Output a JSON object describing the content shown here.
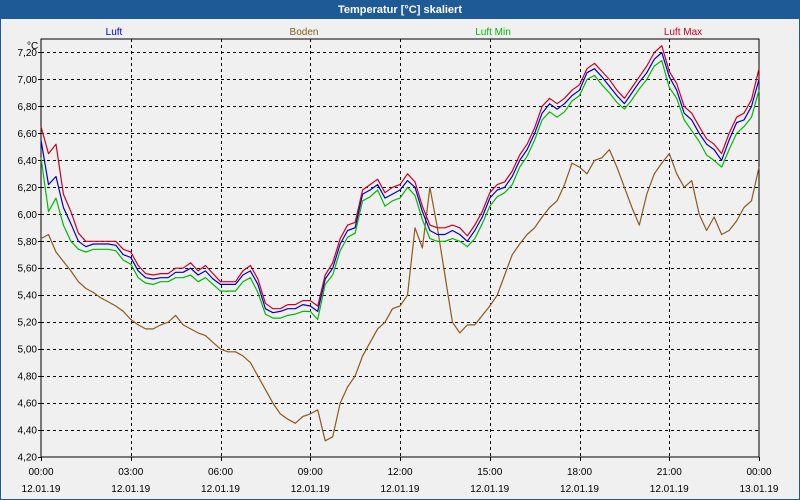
{
  "window": {
    "title": "Temperatur [°C] skaliert"
  },
  "colors": {
    "background": "#f0f0f0",
    "titlebar": "#1e5a96",
    "luft": "#0000cc",
    "boden": "#8b5a1e",
    "luft_min": "#00bb00",
    "luft_max": "#cc0022"
  },
  "chart_data": {
    "type": "line",
    "title": "Temperatur [°C] skaliert",
    "unit": "°C",
    "ylim": [
      4.2,
      7.3
    ],
    "xlim": [
      0,
      24
    ],
    "yticks": [
      4.2,
      4.4,
      4.6,
      4.8,
      5.0,
      5.2,
      5.4,
      5.6,
      5.8,
      6.0,
      6.2,
      6.4,
      6.6,
      6.8,
      7.0,
      7.2
    ],
    "ytick_labels": [
      "4,20",
      "4,40",
      "4,60",
      "4,80",
      "5,00",
      "5,20",
      "5,40",
      "5,60",
      "5,80",
      "6,00",
      "6,20",
      "6,40",
      "6,60",
      "6,80",
      "7,00",
      "7,20"
    ],
    "xticks": [
      {
        "time": "00:00",
        "date": "12.01.19",
        "hour": 0
      },
      {
        "time": "03:00",
        "date": "12.01.19",
        "hour": 3
      },
      {
        "time": "06:00",
        "date": "12.01.19",
        "hour": 6
      },
      {
        "time": "09:00",
        "date": "12.01.19",
        "hour": 9
      },
      {
        "time": "12:00",
        "date": "12.01.19",
        "hour": 12
      },
      {
        "time": "15:00",
        "date": "12.01.19",
        "hour": 15
      },
      {
        "time": "18:00",
        "date": "12.01.19",
        "hour": 18
      },
      {
        "time": "21:00",
        "date": "12.01.19",
        "hour": 21
      },
      {
        "time": "00:00",
        "date": "13.01.19",
        "hour": 24
      }
    ],
    "grid": true,
    "legend_position": "top",
    "x": [
      0,
      0.25,
      0.5,
      0.75,
      1,
      1.25,
      1.5,
      1.75,
      2,
      2.25,
      2.5,
      2.75,
      3,
      3.25,
      3.5,
      3.75,
      4,
      4.25,
      4.5,
      4.75,
      5,
      5.25,
      5.5,
      5.75,
      6,
      6.25,
      6.5,
      6.75,
      7,
      7.25,
      7.5,
      7.75,
      8,
      8.25,
      8.5,
      8.75,
      9,
      9.25,
      9.5,
      9.75,
      10,
      10.25,
      10.5,
      10.75,
      11,
      11.25,
      11.5,
      11.75,
      12,
      12.25,
      12.5,
      12.75,
      13,
      13.25,
      13.5,
      13.75,
      14,
      14.25,
      14.5,
      14.75,
      15,
      15.25,
      15.5,
      15.75,
      16,
      16.25,
      16.5,
      16.75,
      17,
      17.25,
      17.5,
      17.75,
      18,
      18.25,
      18.5,
      18.75,
      19,
      19.25,
      19.5,
      19.75,
      20,
      20.25,
      20.5,
      20.75,
      21,
      21.25,
      21.5,
      21.75,
      22,
      22.25,
      22.5,
      22.75,
      23,
      23.25,
      23.5,
      23.75,
      24
    ],
    "series": [
      {
        "name": "Luft",
        "color": "#0000cc",
        "values": [
          6.55,
          6.22,
          6.28,
          6.05,
          5.93,
          5.8,
          5.76,
          5.78,
          5.78,
          5.78,
          5.77,
          5.7,
          5.68,
          5.58,
          5.53,
          5.52,
          5.53,
          5.53,
          5.57,
          5.57,
          5.6,
          5.55,
          5.58,
          5.52,
          5.48,
          5.48,
          5.48,
          5.55,
          5.58,
          5.48,
          5.3,
          5.27,
          5.28,
          5.3,
          5.3,
          5.33,
          5.32,
          5.28,
          5.52,
          5.6,
          5.78,
          5.88,
          5.9,
          6.15,
          6.18,
          6.22,
          6.12,
          6.15,
          6.18,
          6.25,
          6.2,
          6.02,
          5.88,
          5.85,
          5.85,
          5.88,
          5.85,
          5.8,
          5.88,
          5.98,
          6.12,
          6.18,
          6.2,
          6.28,
          6.4,
          6.48,
          6.6,
          6.75,
          6.82,
          6.78,
          6.82,
          6.88,
          6.92,
          7.05,
          7.08,
          7.02,
          6.95,
          6.88,
          6.82,
          6.9,
          6.98,
          7.05,
          7.15,
          7.2,
          7.02,
          6.92,
          6.75,
          6.7,
          6.6,
          6.52,
          6.48,
          6.4,
          6.55,
          6.68,
          6.7,
          6.8,
          7.0
        ]
      },
      {
        "name": "Boden",
        "color": "#8b5a1e",
        "values": [
          5.82,
          5.85,
          5.72,
          5.65,
          5.58,
          5.5,
          5.45,
          5.42,
          5.38,
          5.35,
          5.32,
          5.28,
          5.22,
          5.18,
          5.15,
          5.15,
          5.18,
          5.2,
          5.25,
          5.18,
          5.15,
          5.12,
          5.1,
          5.05,
          5.0,
          4.98,
          4.98,
          4.95,
          4.9,
          4.8,
          4.7,
          4.6,
          4.52,
          4.48,
          4.45,
          4.5,
          4.52,
          4.55,
          4.32,
          4.35,
          4.6,
          4.72,
          4.8,
          4.95,
          5.05,
          5.15,
          5.2,
          5.3,
          5.32,
          5.4,
          5.9,
          5.75,
          6.2,
          5.9,
          5.55,
          5.2,
          5.12,
          5.18,
          5.18,
          5.25,
          5.32,
          5.4,
          5.55,
          5.7,
          5.78,
          5.85,
          5.9,
          5.98,
          6.05,
          6.1,
          6.22,
          6.38,
          6.35,
          6.3,
          6.4,
          6.42,
          6.48,
          6.35,
          6.2,
          6.05,
          5.92,
          6.15,
          6.3,
          6.38,
          6.45,
          6.3,
          6.2,
          6.25,
          6.0,
          5.88,
          5.98,
          5.85,
          5.88,
          5.95,
          6.05,
          6.1,
          6.35
        ]
      },
      {
        "name": "Luft Min",
        "color": "#00bb00",
        "values": [
          6.42,
          6.02,
          6.12,
          5.92,
          5.8,
          5.74,
          5.72,
          5.74,
          5.74,
          5.74,
          5.73,
          5.66,
          5.63,
          5.53,
          5.49,
          5.48,
          5.5,
          5.5,
          5.53,
          5.53,
          5.55,
          5.5,
          5.53,
          5.48,
          5.43,
          5.43,
          5.43,
          5.5,
          5.53,
          5.42,
          5.26,
          5.23,
          5.23,
          5.25,
          5.26,
          5.28,
          5.28,
          5.22,
          5.48,
          5.55,
          5.73,
          5.83,
          5.86,
          6.1,
          6.13,
          6.18,
          6.06,
          6.1,
          6.12,
          6.2,
          6.14,
          5.96,
          5.82,
          5.8,
          5.8,
          5.82,
          5.8,
          5.76,
          5.82,
          5.93,
          6.06,
          6.13,
          6.16,
          6.22,
          6.35,
          6.43,
          6.55,
          6.7,
          6.76,
          6.72,
          6.76,
          6.84,
          6.88,
          7.0,
          7.03,
          6.96,
          6.9,
          6.83,
          6.78,
          6.85,
          6.93,
          7.0,
          7.1,
          7.14,
          6.94,
          6.86,
          6.7,
          6.62,
          6.54,
          6.44,
          6.4,
          6.35,
          6.48,
          6.6,
          6.65,
          6.72,
          6.92
        ]
      },
      {
        "name": "Luft Max",
        "color": "#cc0022",
        "values": [
          6.65,
          6.45,
          6.52,
          6.15,
          6.02,
          5.86,
          5.8,
          5.8,
          5.8,
          5.8,
          5.8,
          5.74,
          5.72,
          5.62,
          5.56,
          5.55,
          5.56,
          5.56,
          5.6,
          5.6,
          5.64,
          5.58,
          5.62,
          5.56,
          5.5,
          5.5,
          5.5,
          5.58,
          5.62,
          5.52,
          5.34,
          5.3,
          5.3,
          5.33,
          5.33,
          5.36,
          5.36,
          5.32,
          5.55,
          5.64,
          5.82,
          5.92,
          5.94,
          6.18,
          6.22,
          6.26,
          6.16,
          6.2,
          6.22,
          6.3,
          6.24,
          6.06,
          5.92,
          5.9,
          5.9,
          5.92,
          5.9,
          5.84,
          5.92,
          6.02,
          6.16,
          6.22,
          6.24,
          6.32,
          6.44,
          6.52,
          6.64,
          6.8,
          6.86,
          6.82,
          6.86,
          6.92,
          6.96,
          7.08,
          7.12,
          7.06,
          7.0,
          6.92,
          6.86,
          6.94,
          7.02,
          7.1,
          7.2,
          7.25,
          7.06,
          6.97,
          6.8,
          6.75,
          6.65,
          6.56,
          6.52,
          6.45,
          6.6,
          6.72,
          6.75,
          6.85,
          7.08
        ]
      }
    ]
  }
}
